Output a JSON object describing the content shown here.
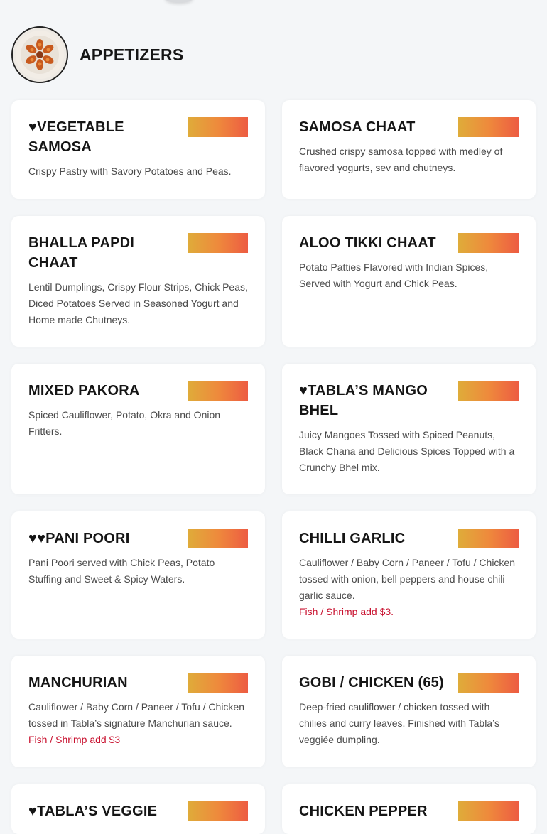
{
  "section": {
    "title": "APPETIZERS",
    "image_icon": "appetizer-plate-image"
  },
  "colors": {
    "background": "#f4f6f8",
    "card": "#ffffff",
    "price_gradient_start": "#dfac3a",
    "price_gradient_end": "#ed5c42",
    "extra_text": "#c8102e"
  },
  "items": [
    {
      "name": "♥VEGETABLE SAMOSA",
      "description": "Crispy Pastry with Savory Potatoes and Peas.",
      "extra": ""
    },
    {
      "name": "SAMOSA CHAAT",
      "description": "Crushed crispy samosa topped with medley of flavored yogurts, sev and chutneys.",
      "extra": ""
    },
    {
      "name": "BHALLA PAPDI CHAAT",
      "description": "Lentil Dumplings, Crispy Flour Strips, Chick Peas, Diced Potatoes Served in Seasoned Yogurt and Home made Chutneys.",
      "extra": ""
    },
    {
      "name": "ALOO TIKKI CHAAT",
      "description": "Potato Patties Flavored with Indian Spices, Served with Yogurt and Chick Peas.",
      "extra": ""
    },
    {
      "name": "MIXED PAKORA",
      "description": "Spiced Cauliflower, Potato, Okra and Onion Fritters.",
      "extra": ""
    },
    {
      "name": "♥TABLA’S MANGO BHEL",
      "description": "Juicy Mangoes Tossed with Spiced Peanuts, Black Chana and Delicious Spices Topped with a Crunchy Bhel mix.",
      "extra": ""
    },
    {
      "name": "♥♥PANI POORI",
      "description": "Pani Poori served with Chick Peas, Potato Stuffing and Sweet & Spicy Waters.",
      "extra": ""
    },
    {
      "name": "CHILLI GARLIC",
      "description": "Cauliflower / Baby Corn / Paneer / Tofu / Chicken tossed with onion, bell peppers and house chili garlic sauce.",
      "extra": "Fish / Shrimp add $3."
    },
    {
      "name": "MANCHURIAN",
      "description": "Cauliflower / Baby Corn / Paneer / Tofu / Chicken tossed in Tabla’s signature Manchurian sauce.",
      "extra": "Fish / Shrimp add $3"
    },
    {
      "name": "GOBI / CHICKEN (65)",
      "description": "Deep-fried cauliflower / chicken tossed with chilies and curry leaves. Finished with Tabla’s veggiée dumpling.",
      "extra": ""
    },
    {
      "name": "♥TABLA’S VEGGIE",
      "description": "",
      "extra": ""
    },
    {
      "name": "CHICKEN PEPPER",
      "description": "",
      "extra": ""
    }
  ]
}
